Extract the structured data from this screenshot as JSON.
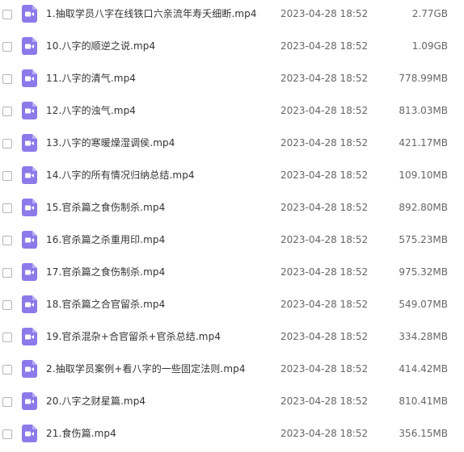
{
  "files": [
    {
      "name": "1.抽取学员八字在线铁口六亲流年寿夭细断.mp4",
      "modified": "2023-04-28 18:52",
      "size": "2.77GB",
      "icon": "video-file-icon"
    },
    {
      "name": "10.八字的顺逆之说.mp4",
      "modified": "2023-04-28 18:52",
      "size": "1.09GB",
      "icon": "video-file-icon"
    },
    {
      "name": "11.八字的清气.mp4",
      "modified": "2023-04-28 18:52",
      "size": "778.99MB",
      "icon": "video-file-icon"
    },
    {
      "name": "12.八字的浊气.mp4",
      "modified": "2023-04-28 18:52",
      "size": "813.03MB",
      "icon": "video-file-icon"
    },
    {
      "name": "13.八字的寒暖燥湿调侯.mp4",
      "modified": "2023-04-28 18:52",
      "size": "421.17MB",
      "icon": "video-file-icon"
    },
    {
      "name": "14.八字的所有情况归纳总结.mp4",
      "modified": "2023-04-28 18:52",
      "size": "109.10MB",
      "icon": "video-file-icon"
    },
    {
      "name": "15.官杀篇之食伤制杀.mp4",
      "modified": "2023-04-28 18:52",
      "size": "892.80MB",
      "icon": "video-file-icon"
    },
    {
      "name": "16.官杀篇之杀重用印.mp4",
      "modified": "2023-04-28 18:52",
      "size": "575.23MB",
      "icon": "video-file-icon"
    },
    {
      "name": "17.官杀篇之食伤制杀.mp4",
      "modified": "2023-04-28 18:52",
      "size": "975.32MB",
      "icon": "video-file-icon"
    },
    {
      "name": "18.官杀篇之合官留杀.mp4",
      "modified": "2023-04-28 18:52",
      "size": "549.07MB",
      "icon": "video-file-icon"
    },
    {
      "name": "19.官杀混杂+合官留杀+官杀总结.mp4",
      "modified": "2023-04-28 18:52",
      "size": "334.28MB",
      "icon": "video-file-icon"
    },
    {
      "name": "2.抽取学员案例+看八字的一些固定法则.mp4",
      "modified": "2023-04-28 18:52",
      "size": "414.42MB",
      "icon": "video-file-icon"
    },
    {
      "name": "20.八字之财星篇.mp4",
      "modified": "2023-04-28 18:52",
      "size": "810.41MB",
      "icon": "video-file-icon"
    },
    {
      "name": "21.食伤篇.mp4",
      "modified": "2023-04-28 18:52",
      "size": "356.15MB",
      "icon": "video-file-icon"
    }
  ],
  "colors": {
    "icon_purple": "#8c79ea",
    "name_text": "#333333",
    "meta_text": "#666666",
    "checkbox_border": "#b5b5b5"
  }
}
